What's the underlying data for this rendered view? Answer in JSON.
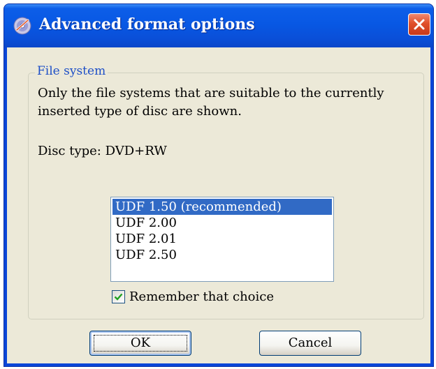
{
  "window": {
    "title": "Advanced format options",
    "icon": "disc-burner-icon",
    "close_icon": "close-icon"
  },
  "group": {
    "legend": "File system",
    "description": "Only the file systems that are suitable to the currently inserted type of disc are shown.",
    "disc_type": "Disc type: DVD+RW"
  },
  "file_systems": {
    "items": [
      "UDF 1.50 (recommended)",
      "UDF 2.00",
      "UDF 2.01",
      "UDF 2.50"
    ],
    "selected": "UDF 1.50 (recommended)"
  },
  "remember": {
    "label": "Remember that choice",
    "checked": true
  },
  "buttons": {
    "ok": "OK",
    "cancel": "Cancel"
  },
  "colors": {
    "titlebar": "#0858e4",
    "selection": "#316ac5",
    "dialog_bg": "#ece9d8",
    "close_button": "#e0502a"
  }
}
